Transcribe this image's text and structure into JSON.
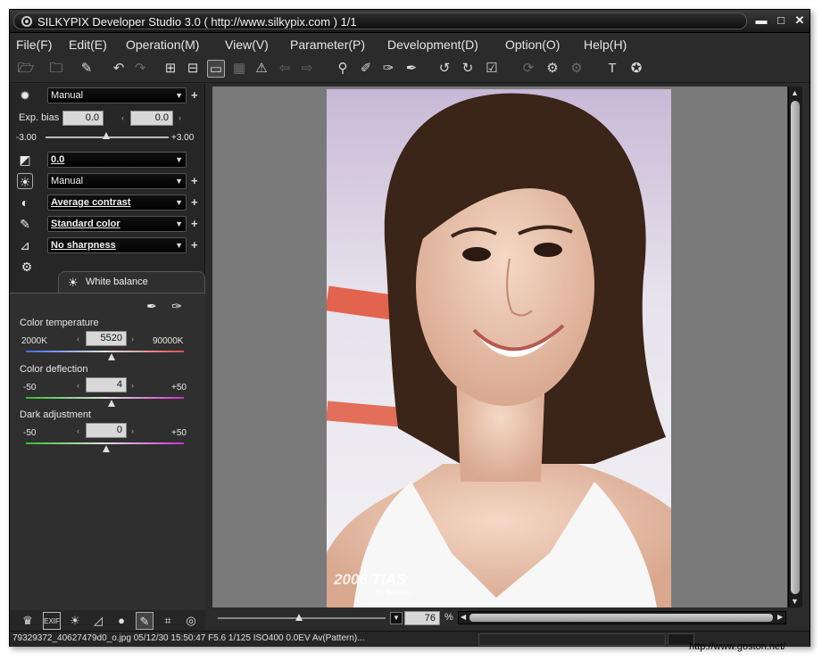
{
  "window": {
    "title": "SILKYPIX Developer Studio 3.0 ( http://www.silkypix.com )    1/1",
    "minimize": "▬",
    "maximize": "□",
    "close": "✕"
  },
  "menu": [
    "File(F)",
    "Edit(E)",
    "Operation(M)",
    "View(V)",
    "Parameter(P)",
    "Development(D)",
    "Option(O)",
    "Help(H)"
  ],
  "toolbar": {
    "icons": [
      "open-folder-icon",
      "folder-browse-icon",
      "tools-icon",
      "undo-icon",
      "redo-icon",
      "grid-view-icon",
      "split-view-icon",
      "single-view-icon",
      "compare-view-icon",
      "warning-icon",
      "prev-icon",
      "next-icon",
      "zoom-icon",
      "eyedropper-icon",
      "eyedropper-alt-icon",
      "eyedropper-gray-icon",
      "rotate-left-icon",
      "rotate-right-icon",
      "check-icon",
      "refresh-icon",
      "develop-icon",
      "batch-develop-icon",
      "hammer-icon",
      "settings-icon"
    ]
  },
  "params": {
    "taste": "Manual",
    "exp_bias_label": "Exp. bias",
    "exp_bias_value": "0.0",
    "exp_bias_value2": "0.0",
    "exp_min": "-3.00",
    "exp_max": "+3.00",
    "exposure": "0.0",
    "white_balance": "Manual",
    "contrast": "Average contrast",
    "color": "Standard color",
    "sharpness": "No sharpness"
  },
  "white_balance_tab": {
    "label": "White balance",
    "color_temperature": {
      "label": "Color temperature",
      "value": "5520",
      "min": "2000K",
      "max": "90000K"
    },
    "color_deflection": {
      "label": "Color deflection",
      "value": "4",
      "min": "-50",
      "max": "+50"
    },
    "dark_adjustment": {
      "label": "Dark adjustment",
      "value": "0",
      "min": "-50",
      "max": "+50"
    }
  },
  "viewer": {
    "zoom": "76",
    "zoom_unit": "%",
    "photo_caption": "2006 TIAS",
    "photo_credit": "by Goston"
  },
  "status": {
    "text": "79329372_40627479d0_o.jpg 05/12/30 15:50:47 F5.6 1/125 ISO400  0.0EV Av(Pattern)..."
  },
  "watermark": "http://www.goston.net/"
}
